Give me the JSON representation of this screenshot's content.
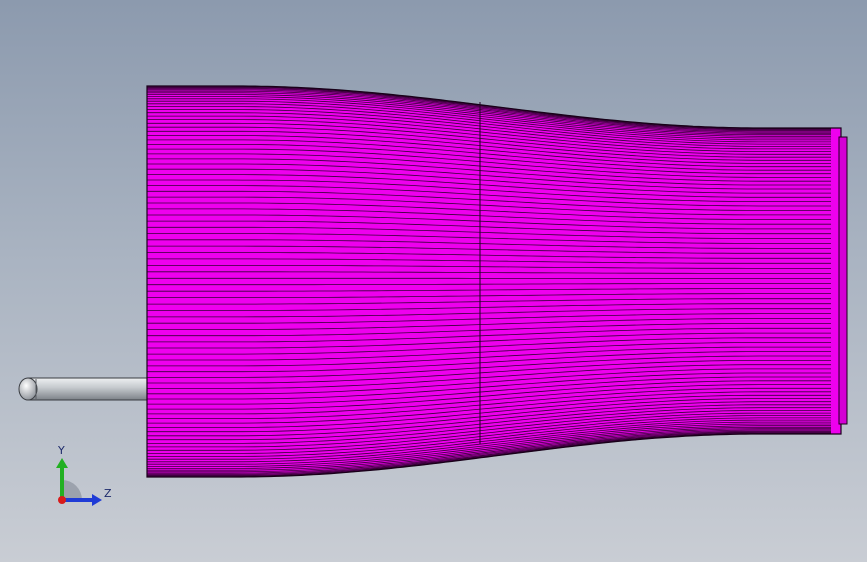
{
  "viewport": {
    "background": [
      "#8c9aae",
      "#c9cdd4"
    ]
  },
  "model": {
    "body_color": "#ee00ee",
    "line_color": "#1a001a",
    "shaft_color": "#c4c8cc",
    "parts": [
      "tapered-body",
      "end-flange",
      "shaft"
    ]
  },
  "triad": {
    "y_label": "Y",
    "z_label": "Z",
    "y_color": "#22b022",
    "z_color": "#1f3bd6",
    "x_color": "#d81b1b"
  }
}
